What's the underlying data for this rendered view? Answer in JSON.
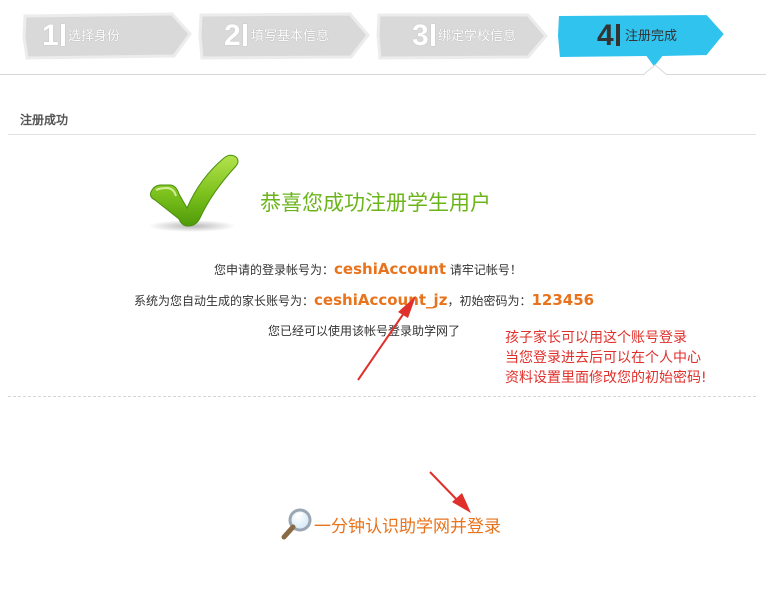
{
  "steps": [
    {
      "num": "1",
      "label": "选择身份",
      "active": false
    },
    {
      "num": "2",
      "label": "填写基本信息",
      "active": false
    },
    {
      "num": "3",
      "label": "绑定学校信息",
      "active": false
    },
    {
      "num": "4",
      "label": "注册完成",
      "active": true
    }
  ],
  "section": {
    "title": "注册成功"
  },
  "success": {
    "heading": "恭喜您成功注册学生用户",
    "line1_prefix": "您申请的登录帐号为：",
    "account": "ceshiAccount",
    "line1_suffix": " 请牢记帐号！",
    "line2_prefix": "系统为您自动生成的家长账号为：",
    "parent_account": "ceshiAccount_jz",
    "line2_mid": "，初始密码为：",
    "password": "123456",
    "line3": "您已经可以使用该帐号登录助学网了"
  },
  "annotation": [
    "孩子家长可以用这个账号登录",
    "当您登录进去后可以在个人中心",
    "资料设置里面修改您的初始密码!"
  ],
  "intro_link": {
    "label": "一分钟认识助学网并登录"
  },
  "colors": {
    "accent_green": "#6bb51b",
    "highlight_orange": "#e8731c",
    "annotation_red": "#e0302b",
    "active_step": "#2fc3ee",
    "inactive_step": "#d9d9d9"
  }
}
